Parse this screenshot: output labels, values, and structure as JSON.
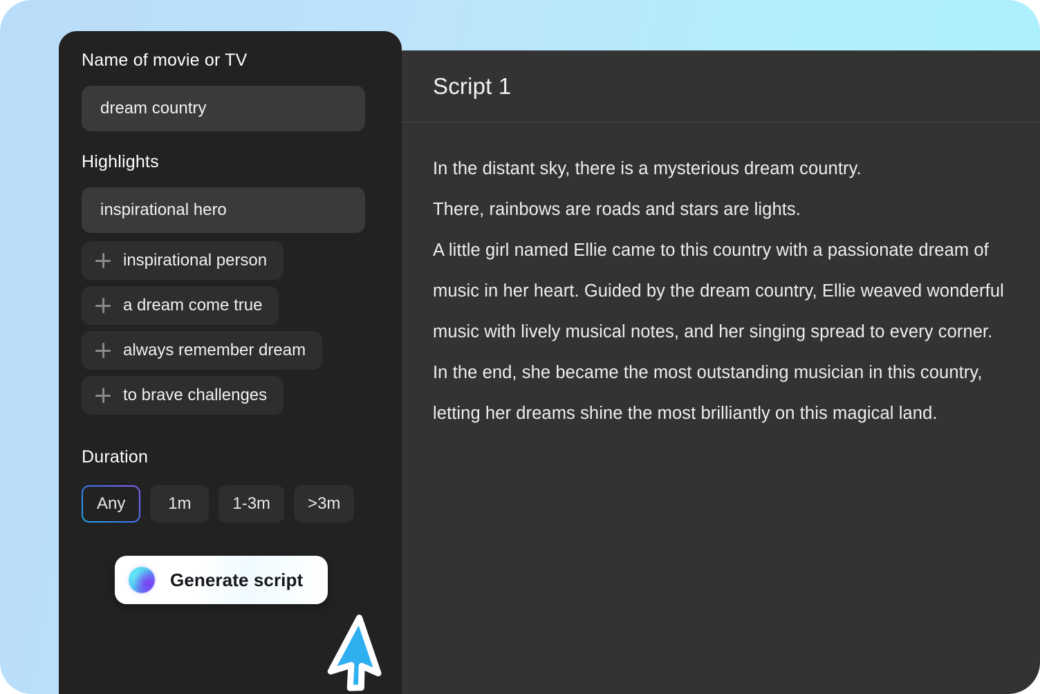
{
  "theme": {
    "background_gradient_start": "#b9dcf9",
    "background_gradient_end": "#a9f1fc",
    "form_panel_bg": "#222222",
    "script_panel_bg": "#333333",
    "input_bg": "#3a3a3a",
    "chip_bg": "#2e2e2e",
    "accent_blue": "#1ea7f0",
    "accent_purple": "#8b5cf6"
  },
  "form": {
    "name_field": {
      "label": "Name of movie or TV",
      "value": "dream country",
      "placeholder": "Name of movie or TV"
    },
    "highlights": {
      "label": "Highlights",
      "value": "inspirational hero",
      "placeholder": "Highlights",
      "suggestions": [
        {
          "icon": "plus-icon",
          "label": "inspirational person"
        },
        {
          "icon": "plus-icon",
          "label": "a dream come true"
        },
        {
          "icon": "plus-icon",
          "label": "always remember dream"
        },
        {
          "icon": "plus-icon",
          "label": "to brave challenges"
        }
      ]
    },
    "duration": {
      "label": "Duration",
      "selected": "Any",
      "options": [
        {
          "label": "Any",
          "selected": true
        },
        {
          "label": "1m",
          "selected": false
        },
        {
          "label": "1-3m",
          "selected": false
        },
        {
          "label": ">3m",
          "selected": false
        }
      ]
    },
    "generate_button": {
      "label": "Generate script",
      "icon": "ai-orb-icon"
    }
  },
  "script": {
    "title": "Script 1",
    "body": "In the distant sky, there is a mysterious dream country.\nThere, rainbows are roads and stars are lights.\nA little girl named Ellie came to this country with a passionate dream of music in her heart. Guided by the dream country, Ellie weaved wonderful music with lively musical notes, and her singing spread to every corner. In the end, she became the most outstanding musician in this country, letting her dreams shine the most brilliantly on this magical land."
  },
  "cursor": {
    "icon": "arrow-pointer-cursor",
    "color": "#2eaff0"
  }
}
